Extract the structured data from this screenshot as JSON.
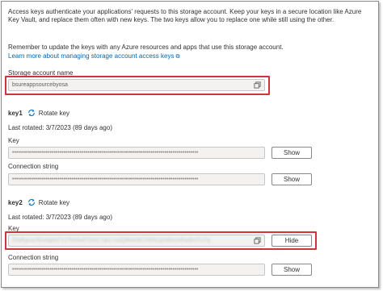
{
  "intro": {
    "paragraph1": "Access keys authenticate your applications' requests to this storage account. Keep your keys in a secure location like Azure Key Vault, and replace them often with new keys. The two keys allow you to replace one while still using the other.",
    "paragraph2": "Remember to update the keys with any Azure resources and apps that use this storage account.",
    "link": "Learn more about managing storage account access keys"
  },
  "account": {
    "label": "Storage account name",
    "value": "bsureappsourcebyosa"
  },
  "key1": {
    "name": "key1",
    "rotate_label": "Rotate key",
    "last_rotated": "Last rotated: 3/7/2023 (89 days ago)",
    "key_label": "Key",
    "key_value": "••••••••••••••••••••••••••••••••••••••••••••••••••••••••••••••••••••••••••••••••••••••••••••••",
    "key_button": "Show",
    "conn_label": "Connection string",
    "conn_value": "••••••••••••••••••••••••••••••••••••••••••••••••••••••••••••••••••••••••••••••••••••••••••••••",
    "conn_button": "Show"
  },
  "key2": {
    "name": "key2",
    "rotate_label": "Rotate key",
    "last_rotated": "Last rotated: 3/7/2023 (89 days ago)",
    "key_label": "Key",
    "key_value": "Zhdfqeoc4kveqbd7Y1TkHw4T2mCYjb1+xuQ8kke8C2W5Ujsx8ecmfrw8mTU7q",
    "key_button": "Hide",
    "conn_label": "Connection string",
    "conn_value": "••••••••••••••••••••••••••••••••••••••••••••••••••••••••••••••••••••••••••••••••••••••••••••••",
    "conn_button": "Show"
  },
  "colors": {
    "highlight": "#d13438",
    "link": "#0067b8",
    "field_bg": "#f3f2f1"
  }
}
